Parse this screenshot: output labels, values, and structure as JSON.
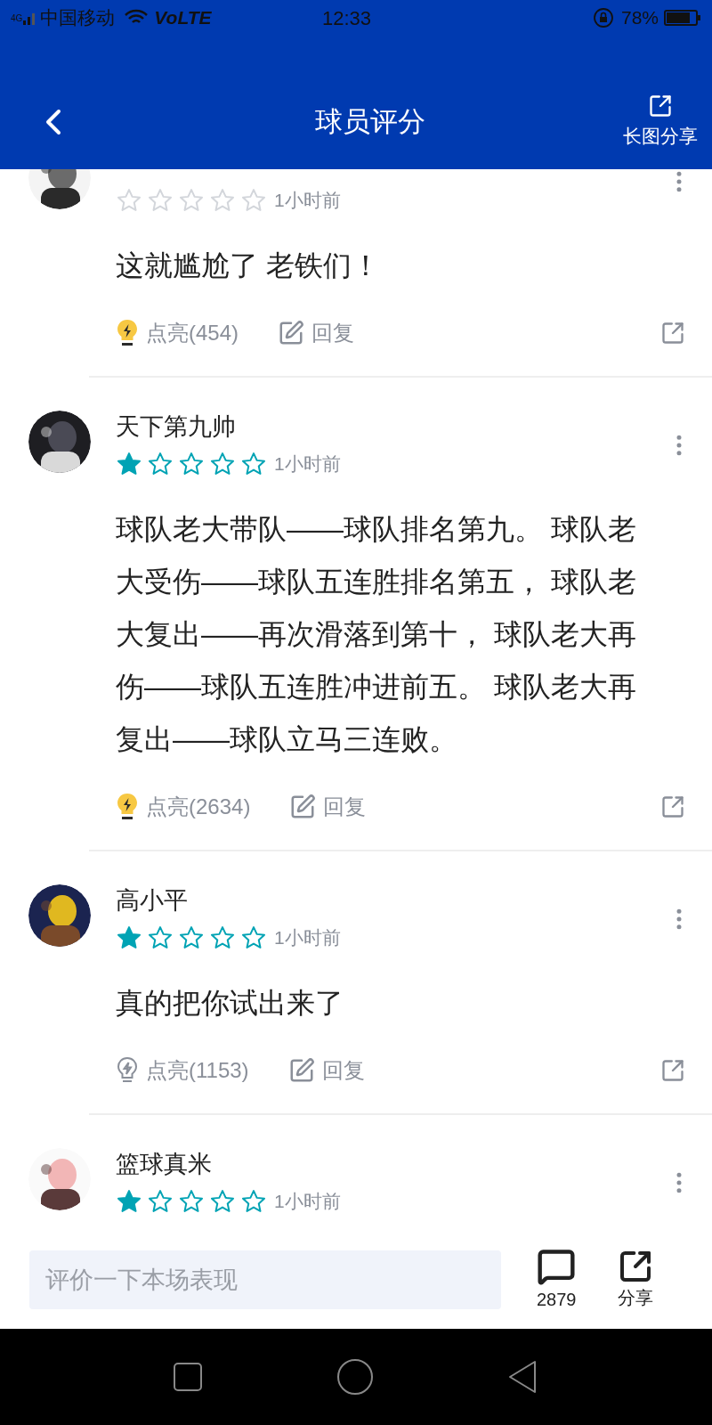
{
  "status_bar": {
    "network": "4G",
    "carrier": "中国移动",
    "volte": "VoLTE",
    "time": "12:33",
    "battery": "78%"
  },
  "header": {
    "title": "球员评分",
    "share_label": "长图分享"
  },
  "comments": [
    {
      "stars": 0,
      "time": "1小时前",
      "content": "这就尴尬了 老铁们！",
      "lit": true,
      "like_label": "点亮(454)",
      "reply_label": "回复"
    },
    {
      "name": "天下第九帅",
      "stars": 1,
      "time": "1小时前",
      "content": "球队老大带队——球队排名第九。 球队老大受伤——球队五连胜排名第五， 球队老大复出——再次滑落到第十， 球队老大再伤——球队五连胜冲进前五。 球队老大再复出——球队立马三连败。",
      "lit": true,
      "like_label": "点亮(2634)",
      "reply_label": "回复"
    },
    {
      "name": "高小平",
      "stars": 1,
      "time": "1小时前",
      "content": "真的把你试出来了",
      "lit": false,
      "like_label": "点亮(1153)",
      "reply_label": "回复"
    },
    {
      "name": "篮球真米",
      "stars": 1,
      "time": "1小时前"
    }
  ],
  "composer": {
    "placeholder": "评价一下本场表现",
    "comment_count": "2879",
    "share_label": "分享"
  }
}
